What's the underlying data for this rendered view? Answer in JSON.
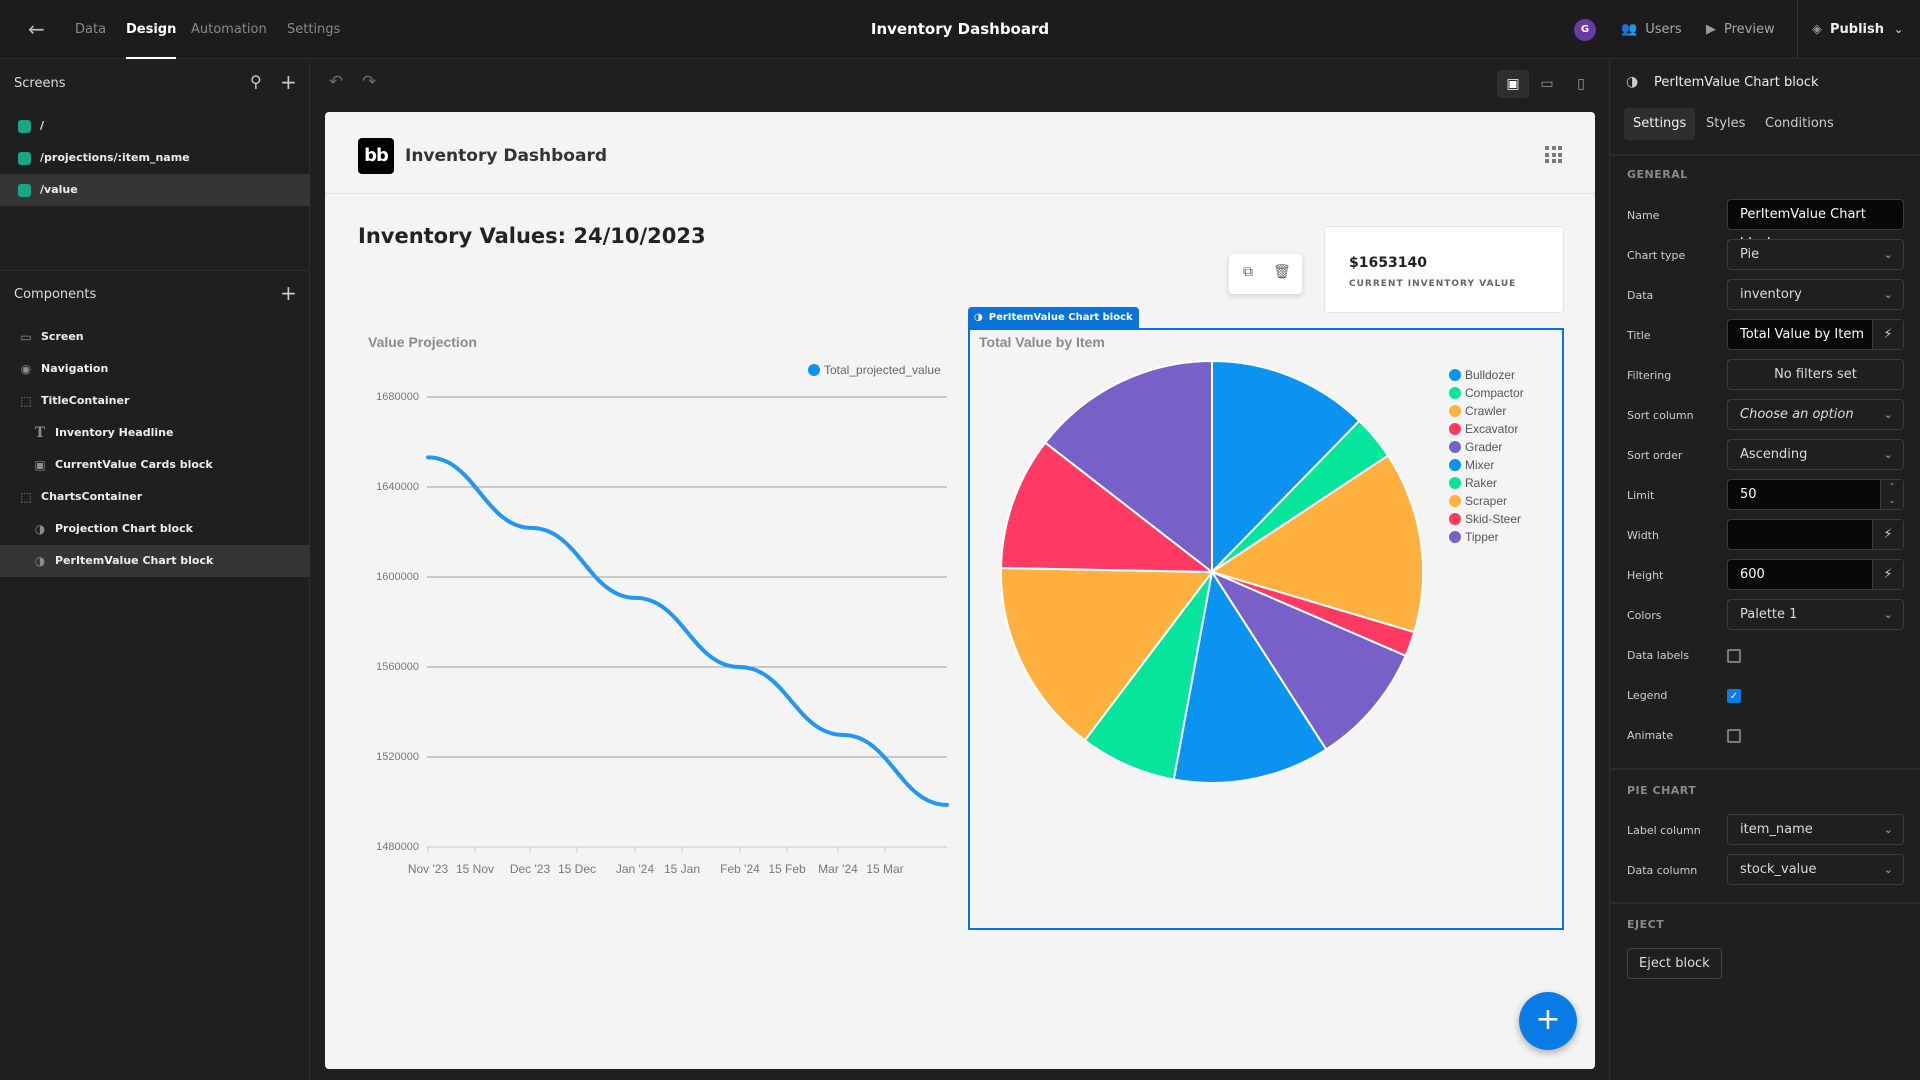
{
  "topbar": {
    "nav": [
      {
        "label": "Data",
        "active": false
      },
      {
        "label": "Design",
        "active": true
      },
      {
        "label": "Automation",
        "active": false
      },
      {
        "label": "Settings",
        "active": false
      }
    ],
    "title": "Inventory Dashboard",
    "avatar_initial": "G",
    "avatar_color": "#6a3aa6",
    "users_label": "Users",
    "preview_label": "Preview",
    "publish_label": "Publish"
  },
  "left": {
    "screens_title": "Screens",
    "screens": [
      {
        "label": "/"
      },
      {
        "label": "/projections/:item_name"
      },
      {
        "label": "/value",
        "selected": true
      }
    ],
    "components_title": "Components",
    "components": [
      {
        "label": "Screen",
        "icon": "screen-icon"
      },
      {
        "label": "Navigation",
        "icon": "eye-icon"
      },
      {
        "label": "TitleContainer",
        "icon": "container-icon"
      },
      {
        "label": "Inventory Headline",
        "icon": "text-icon"
      },
      {
        "label": "CurrentValue Cards block",
        "icon": "cards-icon"
      },
      {
        "label": "ChartsContainer",
        "icon": "container-icon"
      },
      {
        "label": "Projection Chart block",
        "icon": "chart-icon"
      },
      {
        "label": "PerItemValue Chart block",
        "icon": "chart-icon",
        "selected": true
      }
    ]
  },
  "app": {
    "logo_text": "bb",
    "name": "Inventory Dashboard",
    "headline": "Inventory Values: 24/10/2023",
    "card_value": "$1653140",
    "card_label": "CURRENT INVENTORY VALUE",
    "selected_tag": "PerItemValue Chart block"
  },
  "chart_data": [
    {
      "type": "line",
      "title": "Value Projection",
      "legend": [
        "Total_projected_value"
      ],
      "legend_position": "top-right",
      "color": "#2196f3",
      "x_tick_labels": [
        "Nov '23",
        "15 Nov",
        "Dec '23",
        "15 Dec",
        "Jan '24",
        "15 Jan",
        "Feb '24",
        "15 Feb",
        "Mar '24",
        "15 Mar"
      ],
      "y_tick_labels": [
        "1680000",
        "1640000",
        "1600000",
        "1560000",
        "1520000",
        "1480000"
      ],
      "ylim": [
        1480000,
        1680000
      ],
      "x": [
        "2023-11-01",
        "2023-12-01",
        "2024-01-01",
        "2024-02-01",
        "2024-03-01",
        "2024-04-01"
      ],
      "series": [
        {
          "name": "Total_projected_value",
          "values": [
            1653140,
            1621800,
            1590700,
            1560000,
            1529800,
            1498700
          ]
        }
      ],
      "grid": true
    },
    {
      "type": "pie",
      "title": "Total Value by Item",
      "legend_position": "top-right",
      "categories": [
        "Bulldozer",
        "Compactor",
        "Crawler",
        "Excavator",
        "Grader",
        "Mixer",
        "Raker",
        "Scraper",
        "Skid-Steer",
        "Tipper"
      ],
      "values": [
        12.3,
        3.4,
        13.9,
        1.9,
        9.4,
        12.0,
        7.4,
        15.0,
        10.2,
        14.5
      ],
      "colors": [
        "#0a93f0",
        "#05e59c",
        "#ffb03f",
        "#ff3a63",
        "#7760c8",
        "#0a93f0",
        "#05e59c",
        "#ffb03f",
        "#ff3a63",
        "#7760c8"
      ],
      "value_unit": "percent of total (estimated)"
    }
  ],
  "right": {
    "title": "PerItemValue Chart block",
    "tabs": [
      {
        "label": "Settings",
        "selected": true
      },
      {
        "label": "Styles"
      },
      {
        "label": "Conditions"
      }
    ],
    "general_label": "GENERAL",
    "props": {
      "name": {
        "label": "Name",
        "value": "PerItemValue Chart block"
      },
      "chart_type": {
        "label": "Chart type",
        "value": "Pie"
      },
      "data": {
        "label": "Data",
        "value": "inventory"
      },
      "title": {
        "label": "Title",
        "value": "Total Value by Item"
      },
      "filtering": {
        "label": "Filtering",
        "value": "No filters set"
      },
      "sort_column": {
        "label": "Sort column",
        "placeholder": "Choose an option"
      },
      "sort_order": {
        "label": "Sort order",
        "value": "Ascending"
      },
      "limit": {
        "label": "Limit",
        "value": "50"
      },
      "width": {
        "label": "Width",
        "value": ""
      },
      "height": {
        "label": "Height",
        "value": "600"
      },
      "colors": {
        "label": "Colors",
        "value": "Palette 1"
      },
      "data_labels": {
        "label": "Data labels",
        "checked": false
      },
      "legend": {
        "label": "Legend",
        "checked": true
      },
      "animate": {
        "label": "Animate",
        "checked": false
      }
    },
    "pie_label": "PIE CHART",
    "label_column": {
      "label": "Label column",
      "value": "item_name"
    },
    "data_column": {
      "label": "Data column",
      "value": "stock_value"
    },
    "eject_label": "EJECT",
    "eject_button": "Eject block"
  }
}
